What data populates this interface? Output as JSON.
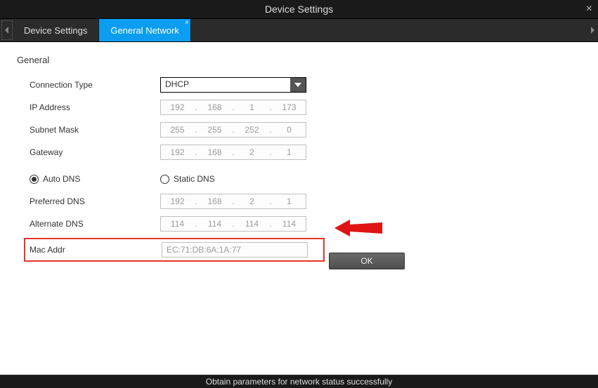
{
  "title": "Device Settings",
  "tabs": {
    "device_settings": "Device Settings",
    "general_network": "General Network"
  },
  "section": "General",
  "labels": {
    "conn_type": "Connection Type",
    "ip": "IP Address",
    "subnet": "Subnet Mask",
    "gateway": "Gateway",
    "auto_dns": "Auto DNS",
    "static_dns": "Static DNS",
    "pref_dns": "Preferred DNS",
    "alt_dns": "Alternate DNS",
    "mac": "Mac Addr"
  },
  "values": {
    "conn_type": "DHCP",
    "ip": [
      "192",
      "168",
      "1",
      "173"
    ],
    "subnet": [
      "255",
      "255",
      "252",
      "0"
    ],
    "gateway": [
      "192",
      "168",
      "2",
      "1"
    ],
    "pref_dns": [
      "192",
      "168",
      "2",
      "1"
    ],
    "alt_dns": [
      "114",
      "114",
      "114",
      "114"
    ],
    "mac": "EC:71:DB:6A:1A:77"
  },
  "buttons": {
    "ok": "OK"
  },
  "status": "Obtain parameters for network status successfully"
}
